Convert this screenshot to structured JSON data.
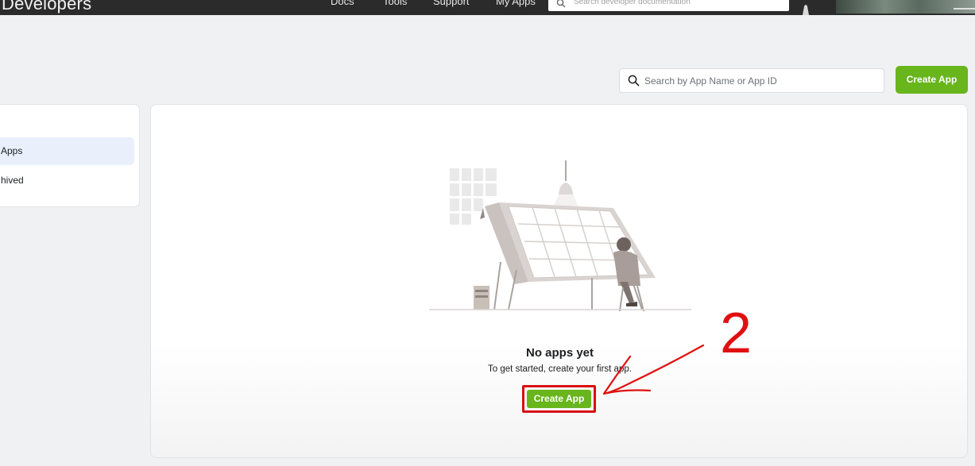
{
  "topnav": {
    "brand": "Developers",
    "links": [
      "Docs",
      "Tools",
      "Support",
      "My Apps"
    ],
    "search_placeholder": "Search developer documentation"
  },
  "toolbar": {
    "search_placeholder": "Search by App Name or App ID",
    "create_label": "Create App"
  },
  "sidebar": {
    "items": [
      {
        "label": "Apps",
        "active": true
      },
      {
        "label": "hived",
        "active": false
      }
    ]
  },
  "empty_state": {
    "title": "No apps yet",
    "subtitle": "To get started, create your first app.",
    "button_label": "Create App",
    "illustration": "person-at-drafting-table-illustration"
  },
  "annotation": {
    "step_number": "2",
    "color": "#e01010"
  },
  "colors": {
    "accent": "#68b51c",
    "topbar": "#2b2b2b",
    "highlight": "#d80f0f"
  }
}
